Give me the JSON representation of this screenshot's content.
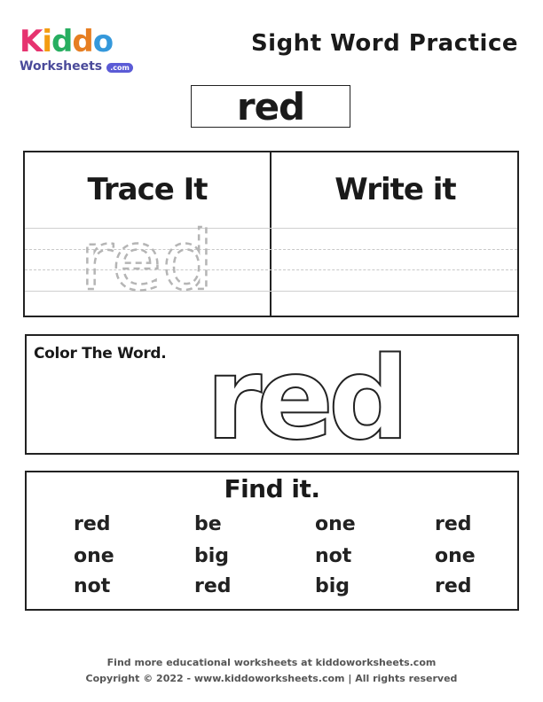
{
  "brand": {
    "logo_letters": [
      "K",
      "i",
      "d",
      "d",
      "o"
    ],
    "logo_colors": [
      "#e6336f",
      "#f39c12",
      "#27ae60",
      "#e67e22",
      "#3498db"
    ],
    "logo_sub": "Worksheets",
    "logo_com": ".com"
  },
  "header": {
    "title": "Sight Word Practice"
  },
  "word": "red",
  "trace_section": {
    "trace_label": "Trace It",
    "write_label": "Write it",
    "trace_word": "red"
  },
  "color_section": {
    "label": "Color The Word.",
    "word": "red"
  },
  "find_section": {
    "title": "Find it.",
    "rows": [
      [
        "red",
        "be",
        "one",
        "red"
      ],
      [
        "one",
        "big",
        "not",
        "one"
      ],
      [
        "not",
        "red",
        "big",
        "red"
      ]
    ]
  },
  "footer": {
    "line1": "Find more educational worksheets at kiddoworksheets.com",
    "line2": "Copyright © 2022 - www.kiddoworksheets.com  |  All rights reserved"
  }
}
